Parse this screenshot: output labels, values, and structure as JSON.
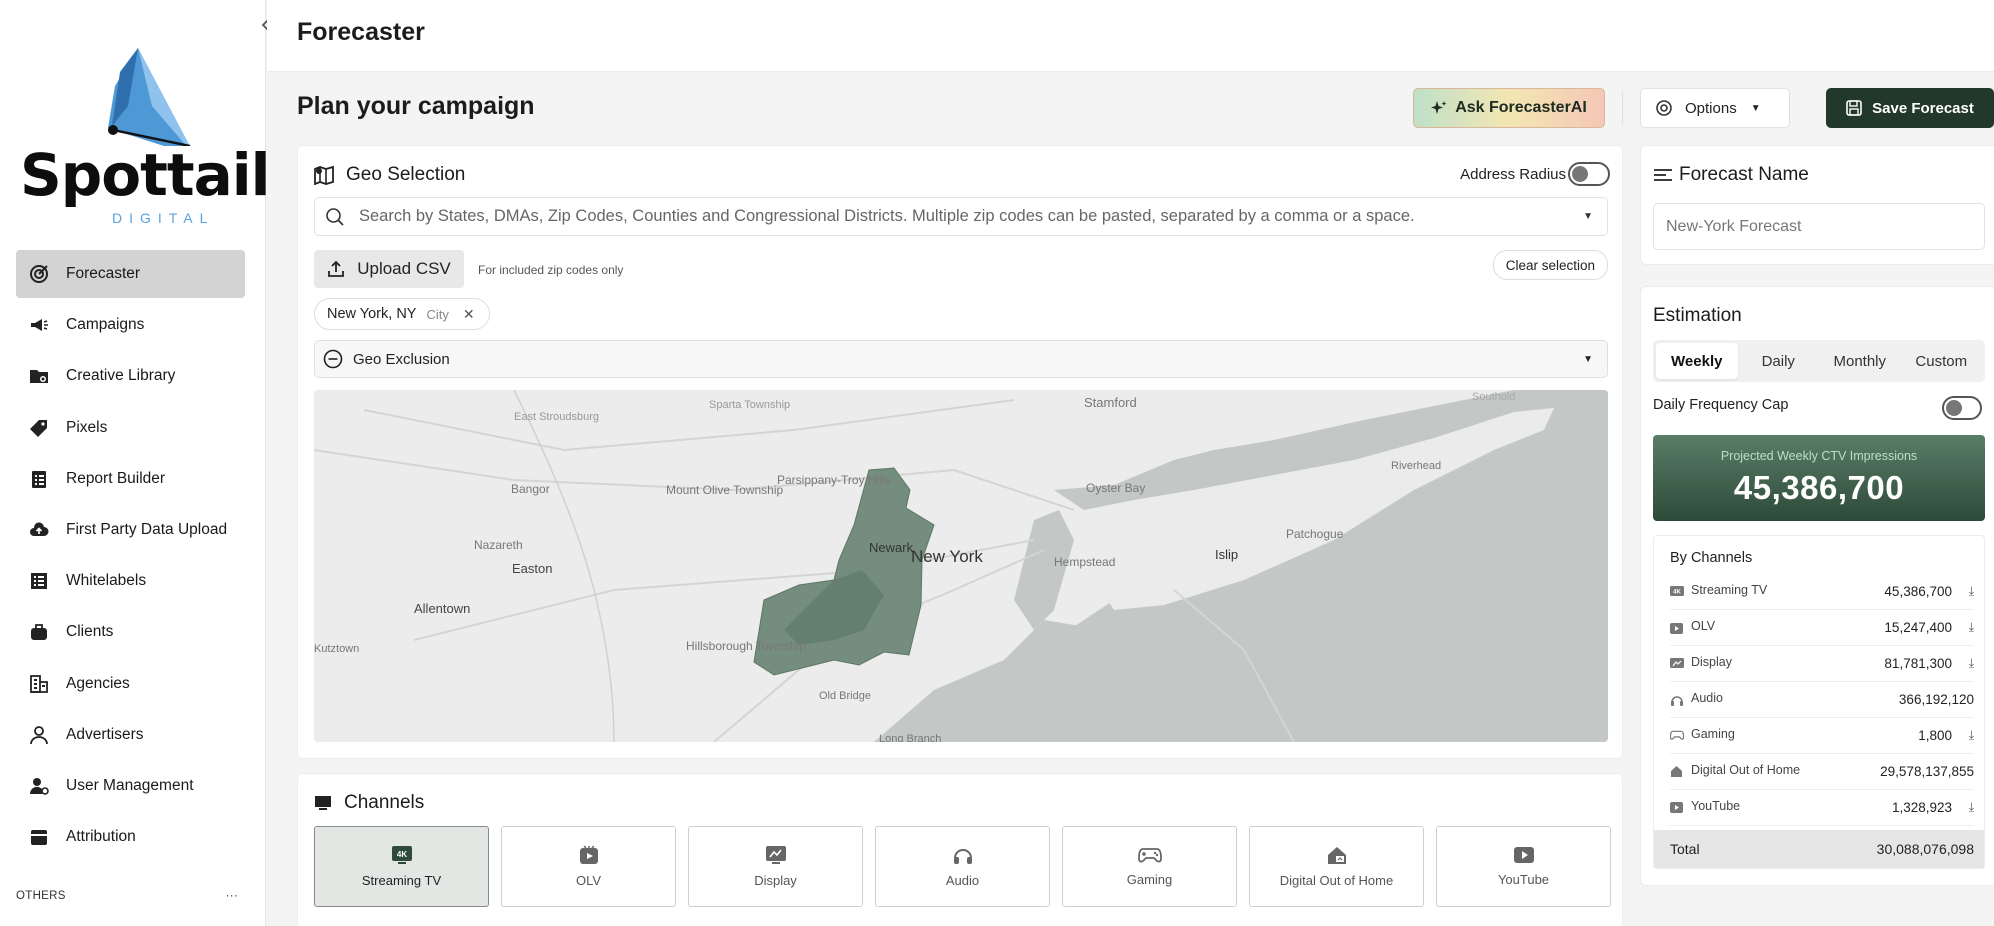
{
  "brand": {
    "name": "Spottail",
    "tagline": "DIGITAL",
    "accent": "#5aa3e0",
    "dark": "#22382b"
  },
  "sidebar": {
    "items": [
      {
        "label": "Forecaster",
        "icon": "target-icon",
        "active": true
      },
      {
        "label": "Campaigns",
        "icon": "megaphone-icon"
      },
      {
        "label": "Creative Library",
        "icon": "folder-icon"
      },
      {
        "label": "Pixels",
        "icon": "tag-icon"
      },
      {
        "label": "Report Builder",
        "icon": "report-icon"
      },
      {
        "label": "First Party Data Upload",
        "icon": "cloud-upload-icon"
      },
      {
        "label": "Whitelabels",
        "icon": "list-icon"
      },
      {
        "label": "Clients",
        "icon": "briefcase-icon"
      },
      {
        "label": "Agencies",
        "icon": "building-icon"
      },
      {
        "label": "Advertisers",
        "icon": "person-icon"
      },
      {
        "label": "User Management",
        "icon": "user-gear-icon"
      },
      {
        "label": "Attribution",
        "icon": "card-icon"
      }
    ],
    "others_label": "OTHERS",
    "others_more": "···"
  },
  "topbar": {
    "title": "Forecaster"
  },
  "plan": {
    "title": "Plan your campaign",
    "ask_label": "Ask ForecasterAI",
    "options_label": "Options",
    "save_label": "Save Forecast"
  },
  "geo": {
    "title": "Geo Selection",
    "address_radius_label": "Address Radius",
    "search_placeholder": "Search by States, DMAs, Zip Codes, Counties and Congressional Districts. Multiple zip codes can be pasted, separated by a comma or a space.",
    "upload_label": "Upload CSV",
    "upload_note": "For included zip codes only",
    "clear_label": "Clear selection",
    "chip": {
      "name": "New York, NY",
      "type": "City"
    },
    "exclusion_label": "Geo Exclusion",
    "map_labels": {
      "stamford": "Stamford",
      "southold": "Southold",
      "sparta": "Sparta Township",
      "east_stroudsburg": "East Stroudsburg",
      "bangor": "Bangor",
      "mount_olive": "Mount Olive Township",
      "parsippany": "Parsippany-Troy Hills",
      "oyster_bay": "Oyster Bay",
      "riverhead": "Riverhead",
      "nazareth": "Nazareth",
      "newark": "Newark",
      "new_york": "New York",
      "hempstead": "Hempstead",
      "islip": "Islip",
      "patchogue": "Patchogue",
      "easton": "Easton",
      "allentown": "Allentown",
      "kutztown": "Kutztown",
      "hillsborough": "Hillsborough Township",
      "old_bridge": "Old Bridge",
      "long_branch": "Long Branch"
    }
  },
  "channels": {
    "title": "Channels",
    "tiles": [
      {
        "label": "Streaming TV",
        "icon": "tv-4k-icon",
        "active": true
      },
      {
        "label": "OLV",
        "icon": "video-icon"
      },
      {
        "label": "Display",
        "icon": "display-icon"
      },
      {
        "label": "Audio",
        "icon": "headphones-icon"
      },
      {
        "label": "Gaming",
        "icon": "gamepad-icon"
      },
      {
        "label": "Digital Out of Home",
        "icon": "billboard-icon"
      },
      {
        "label": "YouTube",
        "icon": "youtube-icon"
      }
    ]
  },
  "forecast_name": {
    "title": "Forecast Name",
    "value": "New-York Forecast"
  },
  "estimation": {
    "title": "Estimation",
    "tabs": [
      "Weekly",
      "Daily",
      "Monthly",
      "Custom"
    ],
    "active_tab": "Weekly",
    "frequency_cap_label": "Daily Frequency Cap",
    "projected_label": "Projected Weekly CTV Impressions",
    "projected_value": "45,386,700",
    "by_channels_label": "By Channels",
    "rows": [
      {
        "name": "Streaming TV",
        "value": "45,386,700",
        "download": true
      },
      {
        "name": "OLV",
        "value": "15,247,400",
        "download": true
      },
      {
        "name": "Display",
        "value": "81,781,300",
        "download": true
      },
      {
        "name": "Audio",
        "value": "366,192,120",
        "download": false
      },
      {
        "name": "Gaming",
        "value": "1,800",
        "download": true
      },
      {
        "name": "Digital Out of Home",
        "value": "29,578,137,855",
        "download": false
      },
      {
        "name": "YouTube",
        "value": "1,328,923",
        "download": true
      }
    ],
    "total_label": "Total",
    "total_value": "30,088,076,098"
  }
}
